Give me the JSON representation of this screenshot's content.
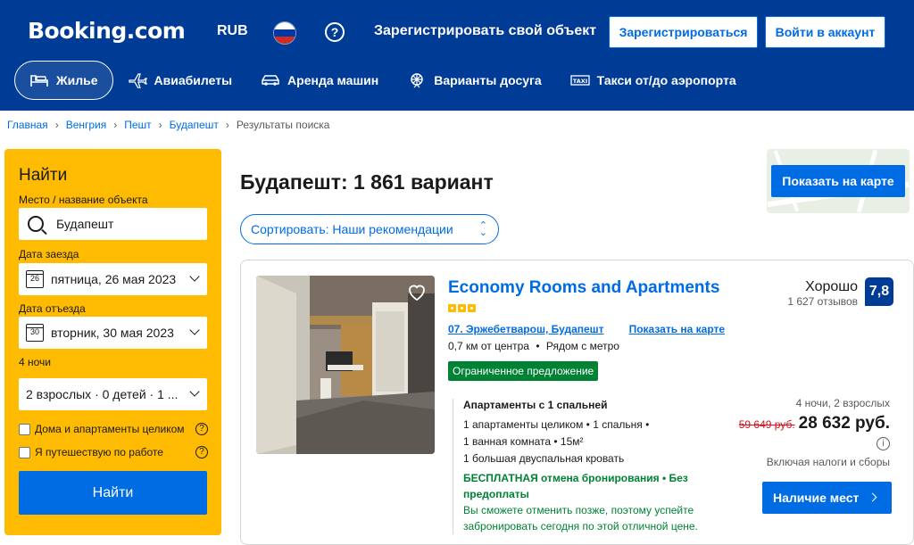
{
  "header": {
    "logo": "Booking.com",
    "currency": "RUB",
    "help": "?",
    "list_property": "Зарегистрировать свой объект",
    "register": "Зарегистрироваться",
    "login": "Войти в аккаунт",
    "colors": {
      "brand": "#003b95",
      "accent": "#006ce4",
      "yellow": "#febb02"
    }
  },
  "nav": [
    {
      "label": "Жилье",
      "icon": "bed-icon"
    },
    {
      "label": "Авиабилеты",
      "icon": "plane-icon"
    },
    {
      "label": "Аренда машин",
      "icon": "car-icon"
    },
    {
      "label": "Варианты досуга",
      "icon": "attractions-icon"
    },
    {
      "label": "Такси от/до аэропорта",
      "icon": "taxi-icon"
    }
  ],
  "breadcrumbs": [
    "Главная",
    "Венгрия",
    "Пешт",
    "Будапешт",
    "Результаты поиска"
  ],
  "search": {
    "title": "Найти",
    "dest_label": "Место / название объекта",
    "dest_value": "Будапешт",
    "checkin_label": "Дата заезда",
    "checkin_day": "26",
    "checkin_value": "пятница, 26 мая 2023",
    "checkout_label": "Дата отъезда",
    "checkout_day": "30",
    "checkout_value": "вторник, 30 мая 2023",
    "nights": "4 ночи",
    "guests": "2 взрослых · 0 детей · 1 ...",
    "check_homes": "Дома и апартаменты целиком",
    "check_work": "Я путешествую по работе",
    "info": "?",
    "button": "Найти"
  },
  "results": {
    "title": "Будапешт: 1 861 вариант",
    "sort": "Сортировать: Наши рекомендации",
    "map_button": "Показать на карте"
  },
  "card": {
    "name": "Economy Rooms and Apartments",
    "stars": 3,
    "district": "07. Эржебетварош, Будапешт",
    "show_on_map": "Показать на карте",
    "distance": "0,7 км от центра",
    "metro": "Рядом с метро",
    "badge": "Ограниченное предложение",
    "score_word": "Хорошо",
    "reviews": "1 627 отзывов",
    "score": "7,8",
    "room_title": "Апартаменты с 1 спальней",
    "room_line1": "1 апартаменты целиком • 1 спальня •",
    "room_line2": "1 ванная комната • 15м²",
    "room_line3": "1 большая двуспальная кровать",
    "free_cancel": "БЕСПЛАТНАЯ отмена бронирования • Без предоплаты",
    "free_note": "Вы сможете отменить позже, поэтому успейте забронировать сегодня по этой отличной цене.",
    "price_meta": "4 ночи, 2 взрослых",
    "old_price": "59 649 руб.",
    "new_price": "28 632 руб.",
    "info": "i",
    "taxes": "Включая налоги и сборы",
    "avail_button": "Наличие мест"
  }
}
